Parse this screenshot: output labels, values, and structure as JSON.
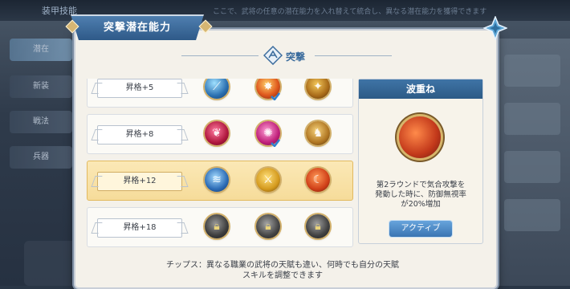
{
  "background": {
    "title": "装甲技能",
    "description": "ここで、武将の任意の潜在能力を入れ替えて統合し、異なる潜在能力を獲得できます",
    "side_items": [
      "潜在",
      "新装",
      "戦法",
      "兵器"
    ]
  },
  "panel": {
    "title": "突撃潜在能力",
    "section_title": "突撃"
  },
  "rows": [
    {
      "rank": "昇格+5",
      "skills": [
        "blue-slash-skill-icon",
        "fire-burst-skill-icon",
        "gold-rune-skill-icon"
      ],
      "checked_index": 1,
      "selected": false
    },
    {
      "rank": "昇格+8",
      "skills": [
        "crimson-skill-icon",
        "pink-swirl-skill-icon",
        "gold-warrior-skill-icon"
      ],
      "checked_index": 1,
      "selected": false
    },
    {
      "rank": "昇格+12",
      "skills": [
        "blue-wave-skill-icon",
        "gold-blade-skill-icon",
        "red-crescent-skill-icon"
      ],
      "checked_index": null,
      "selected": true
    },
    {
      "rank": "昇格+18",
      "skills": [
        "locked-skill-icon",
        "locked-skill-icon",
        "locked-skill-icon"
      ],
      "checked_index": null,
      "selected": false
    }
  ],
  "detail": {
    "name": "波重ね",
    "icon": "red-crescent-skill-icon",
    "description": "第2ラウンドで気合攻撃を\n発動した時に、防御無視率\nが20%増加",
    "status_button": "アクティブ"
  },
  "tips": "チップス：異なる職業の武将の天賦も違い、何時でも自分の天賦\nスキルを調整できます",
  "colors": {
    "accent_blue": "#2e5988",
    "selected_row": "#f6dc9a",
    "gold_frame": "#d2b06a"
  }
}
